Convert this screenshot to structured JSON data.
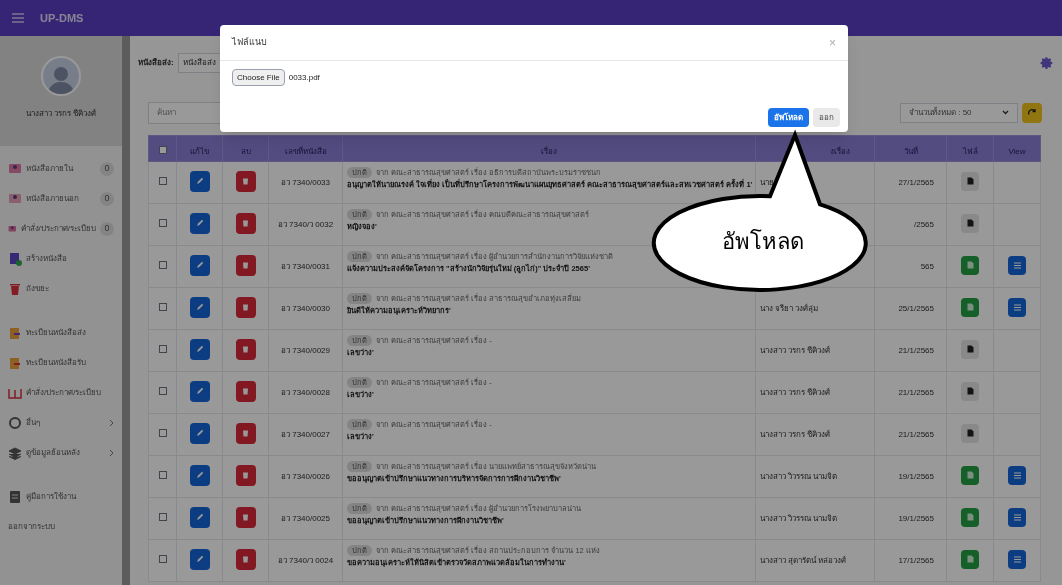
{
  "app": {
    "title": "UP-DMS"
  },
  "profile": {
    "name": "นางสาว วรกร ชีคิวงศ์"
  },
  "sidebar": {
    "items": [
      {
        "label": "หนังสือภายใน",
        "badge": "0",
        "submenu": false
      },
      {
        "label": "หนังสือภายนอก",
        "badge": "0",
        "submenu": false
      },
      {
        "label": "คำสั่ง/ประกาศ/ระเบียบ",
        "badge": "0",
        "submenu": false
      },
      {
        "label": "สร้างหนังสือ",
        "submenu": false
      },
      {
        "label": "ถังขยะ",
        "submenu": false
      },
      {
        "label": "ทะเบียนหนังสือส่ง",
        "submenu": false
      },
      {
        "label": "ทะเบียนหนังสือรับ",
        "submenu": false
      },
      {
        "label": "คำสั่ง/ประกาศ/ระเบียบ",
        "submenu": false
      },
      {
        "label": "อื่นๆ",
        "submenu": true
      },
      {
        "label": "ดูข้อมูลย้อนหลัง",
        "submenu": true
      },
      {
        "label": "คู่มือการใช้งาน",
        "submenu": false
      },
      {
        "label": "ออกจากระบบ",
        "submenu": false
      }
    ]
  },
  "filter": {
    "label": "หนังสือส่ง:",
    "value": "หนังสือส่ง"
  },
  "search": {
    "placeholder": "ค้นหา"
  },
  "page_size": {
    "value": "จำนวนทั้งหมด : 50"
  },
  "table": {
    "header_checked": false,
    "columns": [
      "แก้ไข",
      "ลบ",
      "เลขที่หนังสือ",
      "เรื่อง",
      "งเรื่อง",
      "วันที่",
      "ไฟล์",
      "View"
    ],
    "rows": [
      {
        "checked": false,
        "number": "อว 7340/0033",
        "tag": "ปกติ",
        "line1": "จาก คณะสาธารณสุขศาสตร์ เรื่อง อธิการบดีสถาบันพระบรมราชชนก",
        "line2": "อนุญาตให้นายณรงค์ ใจเที่ยง เป็นที่ปรึกษาโครงการพัฒนาแผนยุทธศาสตร์ คณะสาธารณสุขศาสตร์และสหเวชศาสตร์ ครั้งที่ 1'",
        "sender": "นาย",
        "date": "27/1/2565",
        "kind": "pdf",
        "view": false
      },
      {
        "checked": false,
        "number": "อว 7340/ว 0032",
        "tag": "ปกติ",
        "line1": "จาก คณะสาธารณสุขศาสตร์ เรื่อง คณบดีคณะสาธารณสุขศาสตร์",
        "line2": "หญิงจอง'",
        "date": "/2565",
        "kind": "pdf",
        "view": false
      },
      {
        "checked": false,
        "number": "อว 7340/0031",
        "tag": "ปกติ",
        "line1": "จาก คณะสาธารณสุขศาสตร์ เรื่อง ผู้อำนวยการสำนักงานการวิจัยแห่งชาติ",
        "line2": "แจ้งความประสงค์จัดโครงการ \"สร้างนักวิจัยรุ่นใหม่ (ลูกไก่)\" ประจำปี 2565'",
        "date": "565",
        "kind": "doc",
        "view": true
      },
      {
        "checked": false,
        "number": "อว 7340/0030",
        "tag": "ปกติ",
        "line1": "จาก คณะสาธารณสุขศาสตร์ เรื่อง สาธารณสุขอำเภอทุ่งเสลี่ยม",
        "line2": "ยินดีให้ความอนุเคราะห์วิทยากร'",
        "sender": "นาง จรียา วงศ์ลุ่ม",
        "date": "25/1/2565",
        "kind": "doc",
        "view": true
      },
      {
        "checked": false,
        "number": "อว 7340/0029",
        "tag": "ปกติ",
        "line1": "จาก คณะสาธารณสุขศาสตร์ เรื่อง -",
        "line2": "เลขว่าง'",
        "sender": "นางสาว วรกร ชีคิวงศ์",
        "date": "21/1/2565",
        "kind": "pdf",
        "view": false
      },
      {
        "checked": false,
        "number": "อว 7340/0028",
        "tag": "ปกติ",
        "line1": "จาก คณะสาธารณสุขศาสตร์ เรื่อง -",
        "line2": "เลขว่าง'",
        "sender": "นางสาว วรกร ชีคิวงศ์",
        "date": "21/1/2565",
        "kind": "pdf",
        "view": false
      },
      {
        "checked": false,
        "number": "อว 7340/0027",
        "tag": "ปกติ",
        "line1": "จาก คณะสาธารณสุขศาสตร์ เรื่อง -",
        "line2": "เลขว่าง'",
        "sender": "นางสาว วรกร ชีคิวงศ์",
        "date": "21/1/2565",
        "kind": "pdf",
        "view": false
      },
      {
        "checked": false,
        "number": "อว 7340/0026",
        "tag": "ปกติ",
        "line1": "จาก คณะสาธารณสุขศาสตร์ เรื่อง นายแพทย์สาธารณสุขจังหวัดน่าน",
        "line2": "ขออนุญาตเข้าปรึกษาแนวทางการบริหารจัดการการฝึกงานวิชาชีพ'",
        "sender": "นางสาว วิวรรณ นามจิต",
        "date": "19/1/2565",
        "kind": "doc",
        "view": true
      },
      {
        "checked": false,
        "number": "อว 7340/0025",
        "tag": "ปกติ",
        "line1": "จาก คณะสาธารณสุขศาสตร์ เรื่อง ผู้อำนวยการโรงพยาบาลน่าน",
        "line2": "ขออนุญาตเข้าปรึกษาแนวทางการฝึกงานวิชาชีพ'",
        "sender": "นางสาว วิวรรณ นามจิต",
        "date": "19/1/2565",
        "kind": "doc",
        "view": true
      },
      {
        "checked": false,
        "number": "อว 7340/ว 0024",
        "tag": "ปกติ",
        "line1": "จาก คณะสาธารณสุขศาสตร์ เรื่อง สถานประกอบการ จำนวน 12 แห่ง",
        "line2": "ขอความอนุเคราะห์ให้นิสิตเข้าตรวจวัดสภาพแวดล้อมในการทำงาน'",
        "sender": "นางสาว สุดารัตน์ หล่อวงศ์",
        "date": "17/1/2565",
        "kind": "doc",
        "view": true
      }
    ]
  },
  "modal": {
    "title": "ไฟล์แนบ",
    "close": "×",
    "choose_label": "Choose File",
    "file_name": "0033.pdf",
    "buttons": [
      {
        "label": "อัพโหลด",
        "kind": "primary"
      },
      {
        "label": "ออก",
        "kind": "secondary"
      }
    ]
  },
  "callout": {
    "text": "อัพโหลด"
  }
}
